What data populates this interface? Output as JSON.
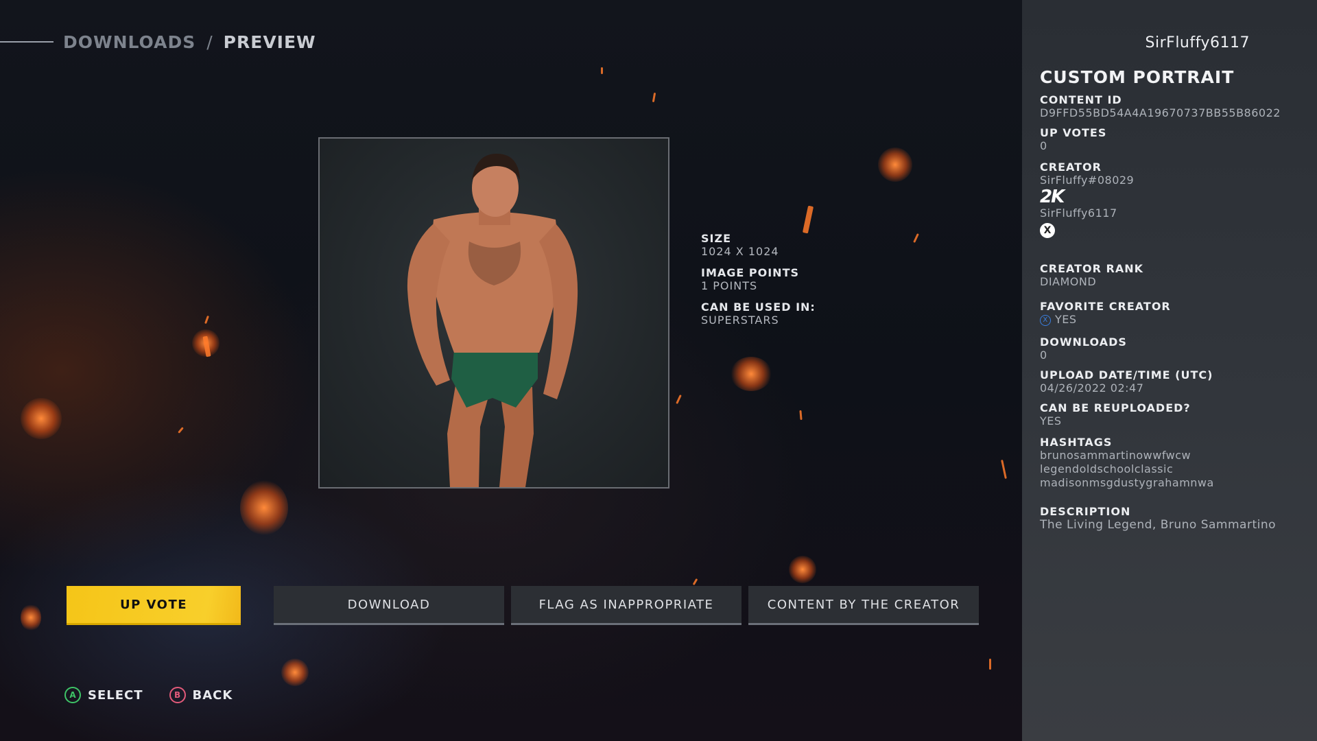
{
  "breadcrumb": {
    "parent": "DOWNLOADS",
    "separator": "/",
    "current": "PREVIEW"
  },
  "preview": {
    "alt": "Custom portrait preview image"
  },
  "meta": {
    "size_label": "SIZE",
    "size_value": "1024 X 1024",
    "points_label": "IMAGE POINTS",
    "points_value": "1 POINTS",
    "usage_label": "CAN BE USED IN:",
    "usage_value": "SUPERSTARS"
  },
  "buttons": {
    "upvote": "UP VOTE",
    "download": "DOWNLOAD",
    "flag": "FLAG AS INAPPROPRIATE",
    "creator_content": "CONTENT BY THE CREATOR"
  },
  "prompts": {
    "select_glyph": "A",
    "select_label": "SELECT",
    "back_glyph": "B",
    "back_label": "BACK"
  },
  "panel": {
    "username": "SirFluffy6117",
    "title": "CUSTOM PORTRAIT",
    "content_id_label": "CONTENT ID",
    "content_id_value": "D9FFD55BD54A4A19670737BB55B86022",
    "upvotes_label": "UP VOTES",
    "upvotes_value": "0",
    "creator_label": "CREATOR",
    "creator_2k_id": "SirFluffy#08029",
    "creator_xbox_id": "SirFluffy6117",
    "logo_2k": "2K",
    "xbox_glyph": "X",
    "rank_label": "CREATOR RANK",
    "rank_value": "DIAMOND",
    "favorite_label": "FAVORITE CREATOR",
    "favorite_glyph": "X",
    "favorite_value": "YES",
    "downloads_label": "DOWNLOADS",
    "downloads_value": "0",
    "upload_label": "UPLOAD DATE/TIME (UTC)",
    "upload_value": "04/26/2022 02:47",
    "reupload_label": "CAN BE REUPLOADED?",
    "reupload_value": "YES",
    "hashtags_label": "HASHTAGS",
    "hashtags": [
      "brunosammartinowwfwcw",
      "legendoldschoolclassic",
      "madisonmsgdustygrahamnwa"
    ],
    "description_label": "DESCRIPTION",
    "description_value": "The Living Legend, Bruno Sammartino"
  },
  "colors": {
    "accent_yellow": "#f5c518",
    "panel_bg": "#2e3238",
    "button_a": "#3ec467",
    "button_b": "#e25a7a"
  }
}
